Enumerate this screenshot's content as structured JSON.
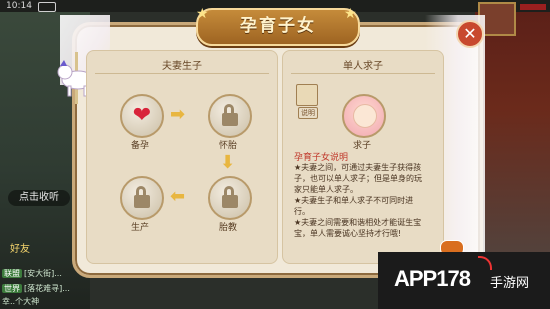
{
  "status": {
    "time": "10:14"
  },
  "panel": {
    "title": "孕育子女",
    "left_header": "夫妻生子",
    "right_header": "单人求子"
  },
  "left_flow": [
    {
      "label": "备孕",
      "icon": "hearts-icon"
    },
    {
      "label": "怀胎",
      "icon": "lock-icon"
    },
    {
      "label": "胎教",
      "icon": "lock-icon"
    },
    {
      "label": "生产",
      "icon": "lock-icon"
    }
  ],
  "right_flow": {
    "label": "求子",
    "book_tag": "说明"
  },
  "description": {
    "title": "孕育子女说明",
    "lines": [
      "★夫妻之间，可通过夫妻生子获得孩",
      "子，也可以单人求子；但是单身的玩",
      "家只能单人求子。",
      "★夫妻生子和单人求子不可同时进",
      "行。",
      "★夫妻之间需要和谐相处才能诞生宝",
      "宝，单人需要诚心坚持才行哦!"
    ]
  },
  "sidebar": {
    "click_collect": "点击收听",
    "friends": "好友",
    "chat": [
      {
        "tag": "联盟",
        "text": "[安大街]..."
      },
      {
        "tag": "世界",
        "text": "[落花难寻]..."
      },
      {
        "tag": "",
        "text": "幸..个大神"
      }
    ]
  },
  "watermark": {
    "brand": "APP178",
    "site": "手游网"
  },
  "colors": {
    "accent": "#c58b3a",
    "panel_bg": "#f1e9d9",
    "desc_title": "#c0392b",
    "close": "#c8492e"
  }
}
